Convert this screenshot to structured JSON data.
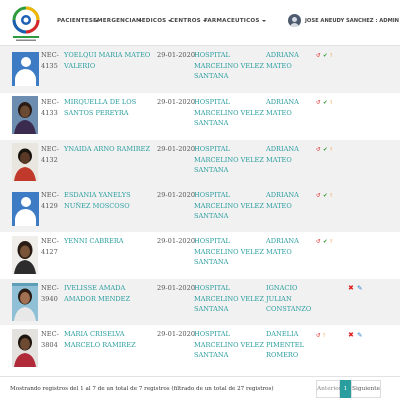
{
  "navbar": {
    "menus": [
      "PACIENTES",
      "EMERGENCIA",
      "MEDICOS",
      "CENTROS",
      "FARMACEUTICOS"
    ],
    "user_label": "JOSE ANEUDY SANCHEZ : ADMIN"
  },
  "table": {
    "rows": [
      {
        "photo": "placeholder-avatar",
        "code": "NEC-4135",
        "name": "YOELQUI MARIA MATEO VALERIO",
        "date": "29-01-2020",
        "hospital": "HOSPITAL MARCELINO VELEZ SANTANA",
        "doctor": "ADRIANA MATEO",
        "actions": [
          "undo-icon",
          "check-icon",
          "exclamation-icon"
        ]
      },
      {
        "photo": "patient-photo",
        "code": "NEC-4133",
        "name": "MIRQUELLA DE LOS SANTOS PEREYRA",
        "date": "29-01-2020",
        "hospital": "HOSPITAL MARCELINO VELEZ SANTANA",
        "doctor": "ADRIANA MATEO",
        "actions": [
          "undo-icon",
          "check-icon",
          "exclamation-icon"
        ]
      },
      {
        "photo": "patient-photo",
        "code": "NEC-4132",
        "name": "YNAIDA ARNO RAMIREZ",
        "date": "29-01-2020",
        "hospital": "HOSPITAL MARCELINO VELEZ SANTANA",
        "doctor": "ADRIANA MATEO",
        "actions": [
          "undo-icon",
          "check-icon",
          "exclamation-icon"
        ]
      },
      {
        "photo": "placeholder-avatar",
        "code": "NEC-4129",
        "name": "ESDANIA YANELYS NUÑEZ MOSCOSO",
        "date": "29-01-2020",
        "hospital": "HOSPITAL MARCELINO VELEZ SANTANA",
        "doctor": "ADRIANA MATEO",
        "actions": [
          "undo-icon",
          "check-icon",
          "exclamation-icon"
        ]
      },
      {
        "photo": "patient-photo",
        "code": "NEC-4127",
        "name": "YENNI CABRERA",
        "date": "29-01-2020",
        "hospital": "HOSPITAL MARCELINO VELEZ SANTANA",
        "doctor": "ADRIANA MATEO",
        "actions": [
          "undo-icon",
          "check-icon",
          "exclamation-icon"
        ]
      },
      {
        "photo": "patient-photo",
        "code": "NEC-3940",
        "name": "IVELISSE AMADA AMADOR MENDEZ",
        "date": "29-01-2020",
        "hospital": "HOSPITAL MARCELINO VELEZ SANTANA",
        "doctor": "IGNACIO JULIAN CONSTANZO",
        "actions": [
          "delete-icon",
          "edit-icon"
        ]
      },
      {
        "photo": "patient-photo",
        "code": "NEC-3804",
        "name": "MARIA CRISELVA MARCELO RAMIREZ",
        "date": "29-01-2020",
        "hospital": "HOSPITAL MARCELINO VELEZ SANTANA",
        "doctor": "DANELIA PIMENTEL ROMERO",
        "actions": [
          "undo-icon",
          "exclamation-icon",
          "delete-icon",
          "edit-icon"
        ]
      }
    ]
  },
  "footer": {
    "info": "Mostrando registros del 1 al 7 de un total de 7 registros (filtrado de un total de 27 registros)",
    "prev_label": "Anterior",
    "current_page": "1",
    "next_label": "Siguiente"
  },
  "colors": {
    "link": "#2a9d9f",
    "row_alt": "#f1f1f1",
    "pager_active": "#2a9d9f",
    "avatar_placeholder": "#3d7cc5"
  }
}
